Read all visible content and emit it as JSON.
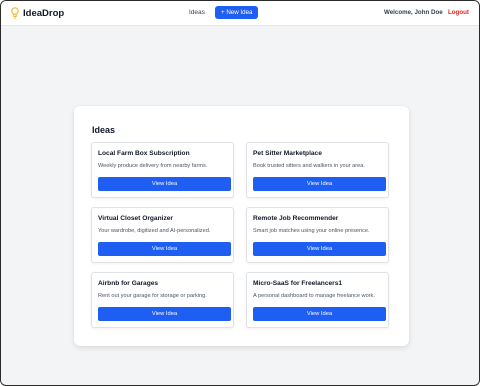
{
  "navbar": {
    "brand": "IdeaDrop",
    "ideas_link": "Ideas",
    "new_idea_button": "+ New Idea",
    "welcome": "Welcome, John Doe",
    "logout": "Logout"
  },
  "main": {
    "title": "Ideas",
    "ideas": [
      {
        "title": "Local Farm Box Subscription",
        "description": "Weekly produce delivery from nearby farms.",
        "button": "View Idea"
      },
      {
        "title": "Pet Sitter Marketplace",
        "description": "Book trusted sitters and walkers in your area.",
        "button": "View Idea"
      },
      {
        "title": "Virtual Closet Organizer",
        "description": "Your wardrobe, digitized and AI-personalized.",
        "button": "View Idea"
      },
      {
        "title": "Remote Job Recommender",
        "description": "Smart job matches using your online presence.",
        "button": "View Idea"
      },
      {
        "title": "Airbnb for Garages",
        "description": "Rent out your garage for storage or parking.",
        "button": "View Idea"
      },
      {
        "title": "Micro-SaaS for Freelancers1",
        "description": "A personal dashboard to manage freelance work.",
        "button": "View Idea"
      }
    ]
  },
  "colors": {
    "accent": "#1f5ef2",
    "logout": "#dc2626",
    "bulb": "#f5b82e",
    "background": "#f3f4f6"
  },
  "icons": {
    "brand": "lightbulb-icon"
  }
}
